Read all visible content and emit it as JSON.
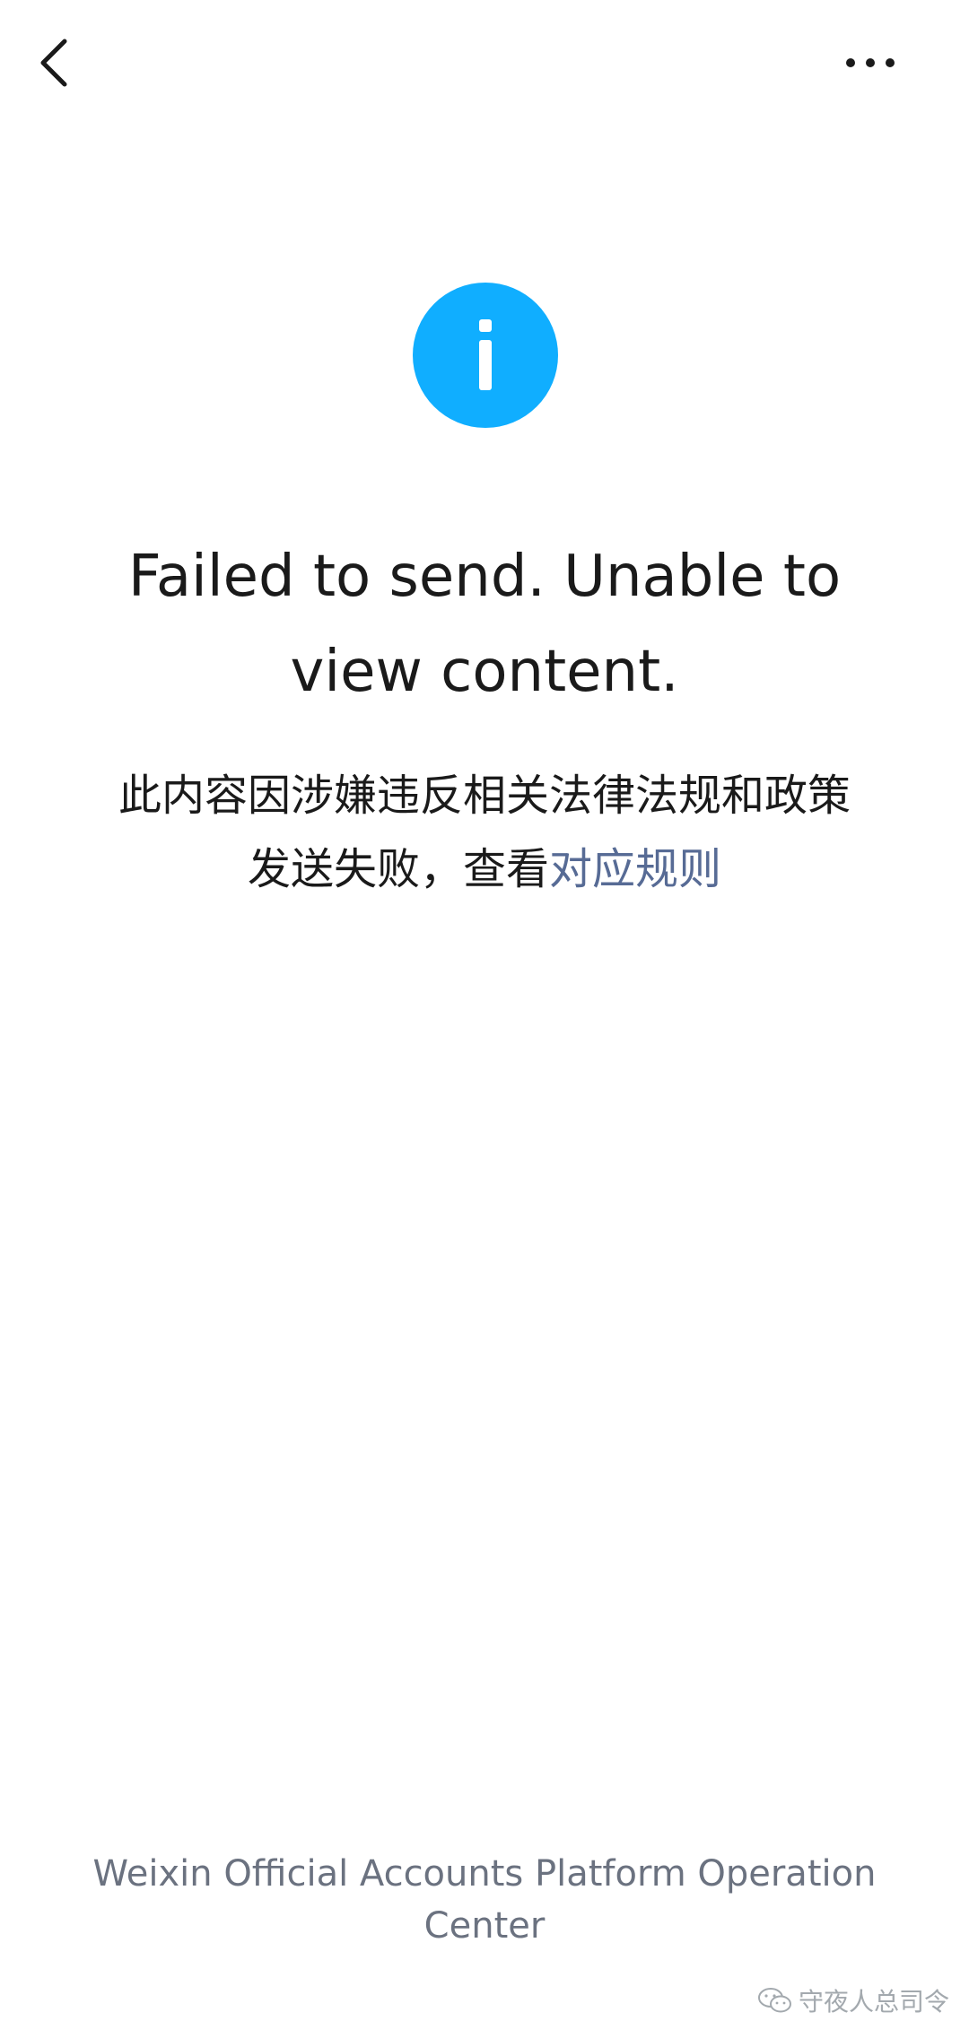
{
  "header": {
    "back_icon": "chevron-left-icon",
    "more_icon": "more-dots-icon"
  },
  "status": {
    "icon": "info-icon",
    "icon_color": "#10aeff",
    "title": "Failed to send. Unable to view content.",
    "description_line1": "此内容因涉嫌违反相关法律法规和政策",
    "description_line2_prefix": "发送失败，查看",
    "rule_link_label": "对应规则",
    "link_color": "#576b95"
  },
  "footer": {
    "operator": "Weixin Official Accounts Platform Operation Center"
  },
  "watermark": {
    "label": "守夜人总司令",
    "icon": "wechat-icon"
  }
}
